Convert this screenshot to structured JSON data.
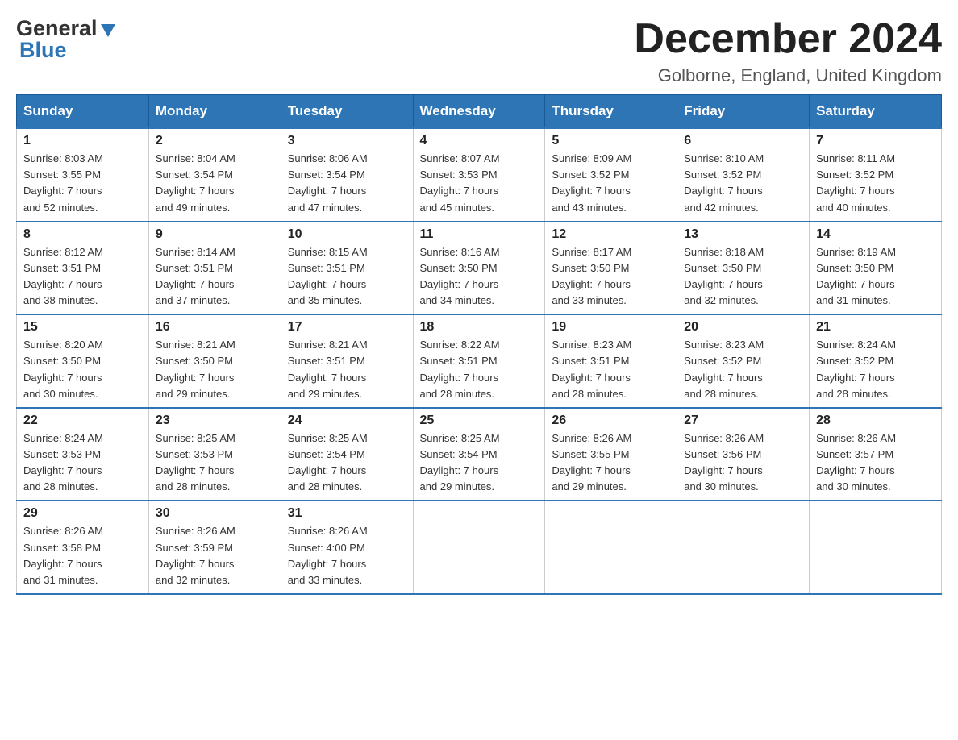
{
  "header": {
    "logo_general": "General",
    "logo_blue": "Blue",
    "month_title": "December 2024",
    "location": "Golborne, England, United Kingdom"
  },
  "weekdays": [
    "Sunday",
    "Monday",
    "Tuesday",
    "Wednesday",
    "Thursday",
    "Friday",
    "Saturday"
  ],
  "weeks": [
    [
      {
        "day": "1",
        "sunrise": "Sunrise: 8:03 AM",
        "sunset": "Sunset: 3:55 PM",
        "daylight": "Daylight: 7 hours",
        "minutes": "and 52 minutes."
      },
      {
        "day": "2",
        "sunrise": "Sunrise: 8:04 AM",
        "sunset": "Sunset: 3:54 PM",
        "daylight": "Daylight: 7 hours",
        "minutes": "and 49 minutes."
      },
      {
        "day": "3",
        "sunrise": "Sunrise: 8:06 AM",
        "sunset": "Sunset: 3:54 PM",
        "daylight": "Daylight: 7 hours",
        "minutes": "and 47 minutes."
      },
      {
        "day": "4",
        "sunrise": "Sunrise: 8:07 AM",
        "sunset": "Sunset: 3:53 PM",
        "daylight": "Daylight: 7 hours",
        "minutes": "and 45 minutes."
      },
      {
        "day": "5",
        "sunrise": "Sunrise: 8:09 AM",
        "sunset": "Sunset: 3:52 PM",
        "daylight": "Daylight: 7 hours",
        "minutes": "and 43 minutes."
      },
      {
        "day": "6",
        "sunrise": "Sunrise: 8:10 AM",
        "sunset": "Sunset: 3:52 PM",
        "daylight": "Daylight: 7 hours",
        "minutes": "and 42 minutes."
      },
      {
        "day": "7",
        "sunrise": "Sunrise: 8:11 AM",
        "sunset": "Sunset: 3:52 PM",
        "daylight": "Daylight: 7 hours",
        "minutes": "and 40 minutes."
      }
    ],
    [
      {
        "day": "8",
        "sunrise": "Sunrise: 8:12 AM",
        "sunset": "Sunset: 3:51 PM",
        "daylight": "Daylight: 7 hours",
        "minutes": "and 38 minutes."
      },
      {
        "day": "9",
        "sunrise": "Sunrise: 8:14 AM",
        "sunset": "Sunset: 3:51 PM",
        "daylight": "Daylight: 7 hours",
        "minutes": "and 37 minutes."
      },
      {
        "day": "10",
        "sunrise": "Sunrise: 8:15 AM",
        "sunset": "Sunset: 3:51 PM",
        "daylight": "Daylight: 7 hours",
        "minutes": "and 35 minutes."
      },
      {
        "day": "11",
        "sunrise": "Sunrise: 8:16 AM",
        "sunset": "Sunset: 3:50 PM",
        "daylight": "Daylight: 7 hours",
        "minutes": "and 34 minutes."
      },
      {
        "day": "12",
        "sunrise": "Sunrise: 8:17 AM",
        "sunset": "Sunset: 3:50 PM",
        "daylight": "Daylight: 7 hours",
        "minutes": "and 33 minutes."
      },
      {
        "day": "13",
        "sunrise": "Sunrise: 8:18 AM",
        "sunset": "Sunset: 3:50 PM",
        "daylight": "Daylight: 7 hours",
        "minutes": "and 32 minutes."
      },
      {
        "day": "14",
        "sunrise": "Sunrise: 8:19 AM",
        "sunset": "Sunset: 3:50 PM",
        "daylight": "Daylight: 7 hours",
        "minutes": "and 31 minutes."
      }
    ],
    [
      {
        "day": "15",
        "sunrise": "Sunrise: 8:20 AM",
        "sunset": "Sunset: 3:50 PM",
        "daylight": "Daylight: 7 hours",
        "minutes": "and 30 minutes."
      },
      {
        "day": "16",
        "sunrise": "Sunrise: 8:21 AM",
        "sunset": "Sunset: 3:50 PM",
        "daylight": "Daylight: 7 hours",
        "minutes": "and 29 minutes."
      },
      {
        "day": "17",
        "sunrise": "Sunrise: 8:21 AM",
        "sunset": "Sunset: 3:51 PM",
        "daylight": "Daylight: 7 hours",
        "minutes": "and 29 minutes."
      },
      {
        "day": "18",
        "sunrise": "Sunrise: 8:22 AM",
        "sunset": "Sunset: 3:51 PM",
        "daylight": "Daylight: 7 hours",
        "minutes": "and 28 minutes."
      },
      {
        "day": "19",
        "sunrise": "Sunrise: 8:23 AM",
        "sunset": "Sunset: 3:51 PM",
        "daylight": "Daylight: 7 hours",
        "minutes": "and 28 minutes."
      },
      {
        "day": "20",
        "sunrise": "Sunrise: 8:23 AM",
        "sunset": "Sunset: 3:52 PM",
        "daylight": "Daylight: 7 hours",
        "minutes": "and 28 minutes."
      },
      {
        "day": "21",
        "sunrise": "Sunrise: 8:24 AM",
        "sunset": "Sunset: 3:52 PM",
        "daylight": "Daylight: 7 hours",
        "minutes": "and 28 minutes."
      }
    ],
    [
      {
        "day": "22",
        "sunrise": "Sunrise: 8:24 AM",
        "sunset": "Sunset: 3:53 PM",
        "daylight": "Daylight: 7 hours",
        "minutes": "and 28 minutes."
      },
      {
        "day": "23",
        "sunrise": "Sunrise: 8:25 AM",
        "sunset": "Sunset: 3:53 PM",
        "daylight": "Daylight: 7 hours",
        "minutes": "and 28 minutes."
      },
      {
        "day": "24",
        "sunrise": "Sunrise: 8:25 AM",
        "sunset": "Sunset: 3:54 PM",
        "daylight": "Daylight: 7 hours",
        "minutes": "and 28 minutes."
      },
      {
        "day": "25",
        "sunrise": "Sunrise: 8:25 AM",
        "sunset": "Sunset: 3:54 PM",
        "daylight": "Daylight: 7 hours",
        "minutes": "and 29 minutes."
      },
      {
        "day": "26",
        "sunrise": "Sunrise: 8:26 AM",
        "sunset": "Sunset: 3:55 PM",
        "daylight": "Daylight: 7 hours",
        "minutes": "and 29 minutes."
      },
      {
        "day": "27",
        "sunrise": "Sunrise: 8:26 AM",
        "sunset": "Sunset: 3:56 PM",
        "daylight": "Daylight: 7 hours",
        "minutes": "and 30 minutes."
      },
      {
        "day": "28",
        "sunrise": "Sunrise: 8:26 AM",
        "sunset": "Sunset: 3:57 PM",
        "daylight": "Daylight: 7 hours",
        "minutes": "and 30 minutes."
      }
    ],
    [
      {
        "day": "29",
        "sunrise": "Sunrise: 8:26 AM",
        "sunset": "Sunset: 3:58 PM",
        "daylight": "Daylight: 7 hours",
        "minutes": "and 31 minutes."
      },
      {
        "day": "30",
        "sunrise": "Sunrise: 8:26 AM",
        "sunset": "Sunset: 3:59 PM",
        "daylight": "Daylight: 7 hours",
        "minutes": "and 32 minutes."
      },
      {
        "day": "31",
        "sunrise": "Sunrise: 8:26 AM",
        "sunset": "Sunset: 4:00 PM",
        "daylight": "Daylight: 7 hours",
        "minutes": "and 33 minutes."
      },
      null,
      null,
      null,
      null
    ]
  ]
}
